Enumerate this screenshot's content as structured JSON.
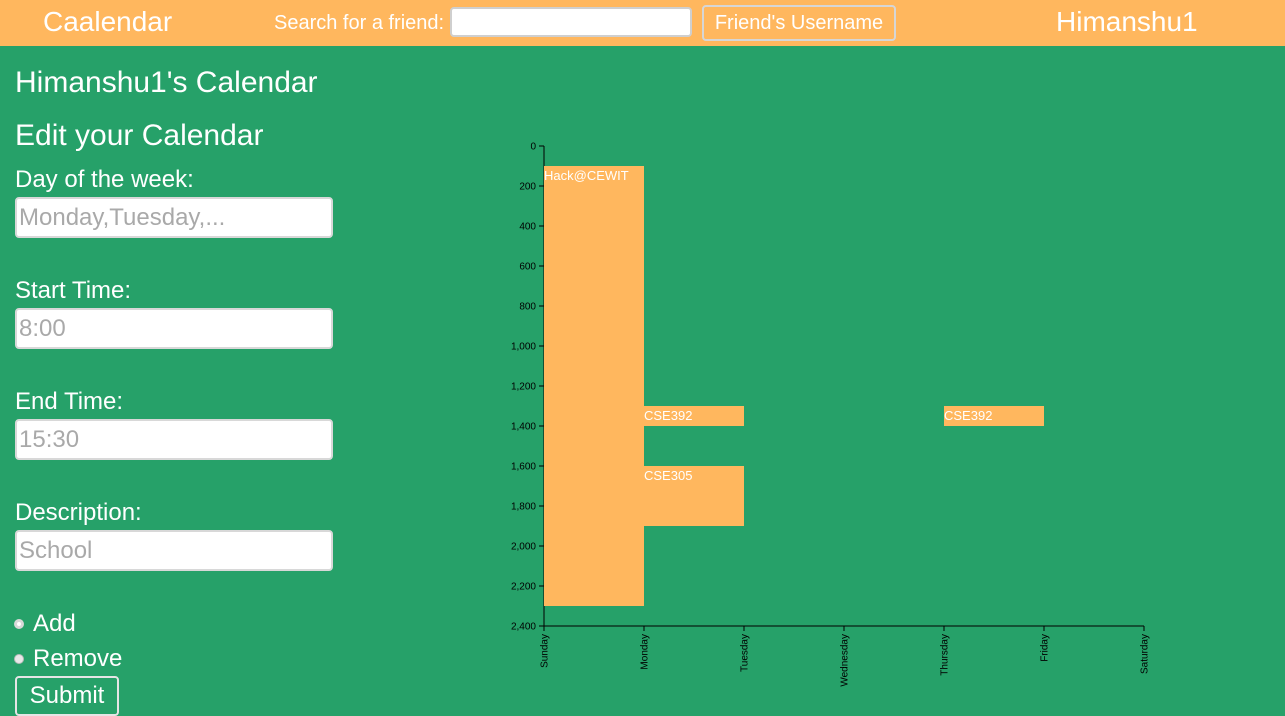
{
  "header": {
    "brand": "Caalendar",
    "search_label": "Search for a friend:",
    "search_value": "",
    "friend_button": "Friend's Username",
    "username": "Himanshu1"
  },
  "main": {
    "page_title": "Himanshu1's Calendar",
    "section_title": "Edit your Calendar"
  },
  "form": {
    "day_label": "Day of the week:",
    "day_placeholder": "Monday,Tuesday,...",
    "start_label": "Start Time:",
    "start_placeholder": "8:00",
    "end_label": "End Time:",
    "end_placeholder": "15:30",
    "desc_label": "Description:",
    "desc_placeholder": "School",
    "radio_add": "Add",
    "radio_remove": "Remove",
    "selected_action": "Add",
    "submit": "Submit"
  },
  "colors": {
    "background": "#26a169",
    "accent": "#ffb75e",
    "text": "#ffffff"
  },
  "chart_data": {
    "type": "bar",
    "categories": [
      "Sunday",
      "Monday",
      "Tuesday",
      "Wednesday",
      "Thursday",
      "Friday",
      "Saturday"
    ],
    "ylim": [
      0,
      2400
    ],
    "y_ticks": [
      0,
      200,
      400,
      600,
      800,
      1000,
      1200,
      1400,
      1600,
      1800,
      2000,
      2200,
      2400
    ],
    "y_tick_labels": [
      "0",
      "200",
      "400",
      "600",
      "800",
      "1,000",
      "1,200",
      "1,400",
      "1,600",
      "1,800",
      "2,000",
      "2,200",
      "2,400"
    ],
    "y_inverted": true,
    "events": [
      {
        "day": "Sunday",
        "start": 100,
        "end": 2300,
        "label": "Hack@CEWIT"
      },
      {
        "day": "Monday",
        "start": 1300,
        "end": 1400,
        "label": "CSE392"
      },
      {
        "day": "Monday",
        "start": 1600,
        "end": 1900,
        "label": "CSE305"
      },
      {
        "day": "Thursday",
        "start": 1300,
        "end": 1400,
        "label": "CSE392"
      }
    ]
  }
}
